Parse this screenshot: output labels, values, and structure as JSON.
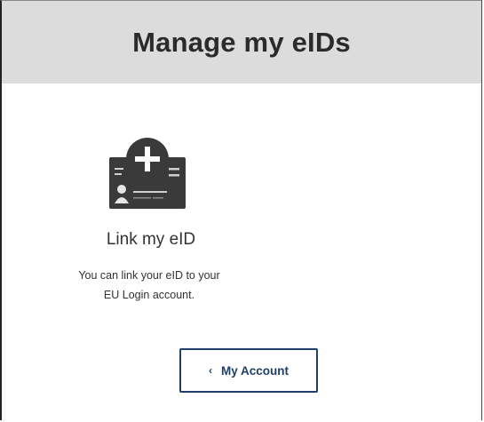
{
  "header": {
    "title": "Manage my eIDs"
  },
  "link_card": {
    "icon": "id-card-add-icon",
    "title": "Link my eID",
    "description_line1": "You can link your eID to your",
    "description_line2": "EU Login account."
  },
  "account_button": {
    "icon": "chevron-left-icon",
    "chevron": "‹",
    "label": "My Account",
    "color": "#1f3f66"
  }
}
